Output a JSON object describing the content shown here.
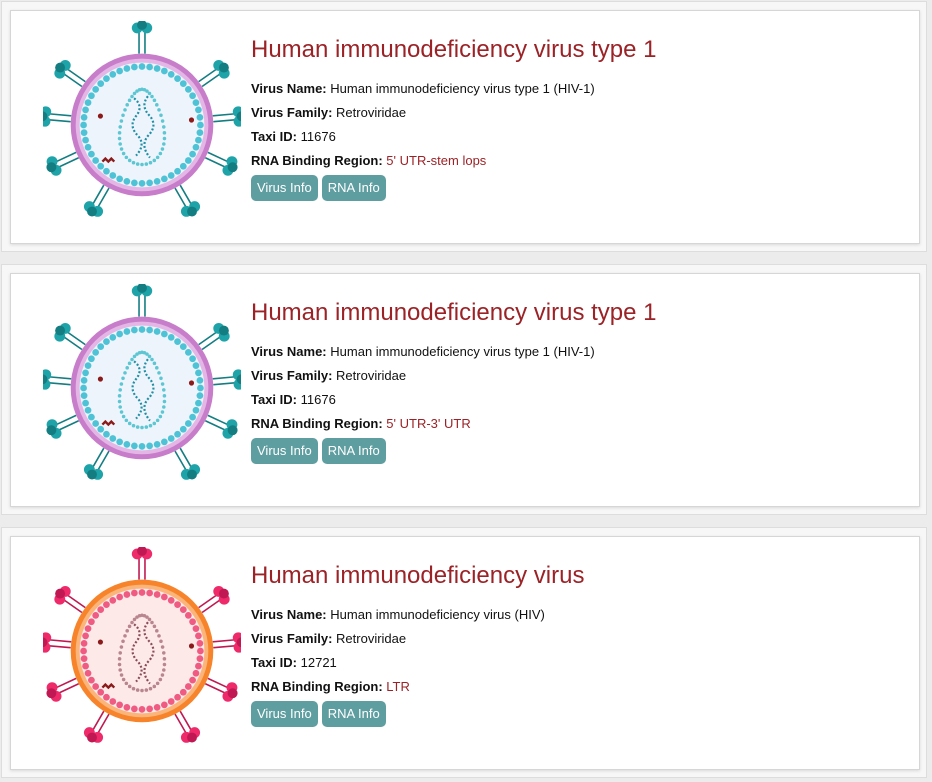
{
  "cards": [
    {
      "title": "Human immunodeficiency virus type 1",
      "name_label": "Virus Name:",
      "name_value": "Human immunodeficiency virus type 1 (HIV-1)",
      "family_label": "Virus Family:",
      "family_value": "Retroviridae",
      "taxi_label": "Taxi ID:",
      "taxi_value": "11676",
      "region_label": "RNA Binding Region:",
      "region_value": "5' UTR-stem lops",
      "virus_info_label": "Virus Info",
      "rna_info_label": "RNA Info",
      "illustration": "virus-teal-icon"
    },
    {
      "title": "Human immunodeficiency virus type 1",
      "name_label": "Virus Name:",
      "name_value": "Human immunodeficiency virus type 1 (HIV-1)",
      "family_label": "Virus Family:",
      "family_value": "Retroviridae",
      "taxi_label": "Taxi ID:",
      "taxi_value": "11676",
      "region_label": "RNA Binding Region:",
      "region_value": "5' UTR-3' UTR",
      "virus_info_label": "Virus Info",
      "rna_info_label": "RNA Info",
      "illustration": "virus-teal-icon"
    },
    {
      "title": "Human immunodeficiency virus",
      "name_label": "Virus Name:",
      "name_value": "Human immunodeficiency virus (HIV)",
      "family_label": "Virus Family:",
      "family_value": "Retroviridae",
      "taxi_label": "Taxi ID:",
      "taxi_value": "12721",
      "region_label": "RNA Binding Region:",
      "region_value": "LTR",
      "virus_info_label": "Virus Info",
      "rna_info_label": "RNA Info",
      "illustration": "virus-pink-icon"
    }
  ],
  "colors": {
    "title": "#9b2226",
    "button": "#5f9ea0",
    "teal_spike": "#1ea3a8",
    "teal_membrane": "#c77dc9",
    "pink_spike": "#ee2a6b",
    "pink_membrane": "#f7842b"
  }
}
